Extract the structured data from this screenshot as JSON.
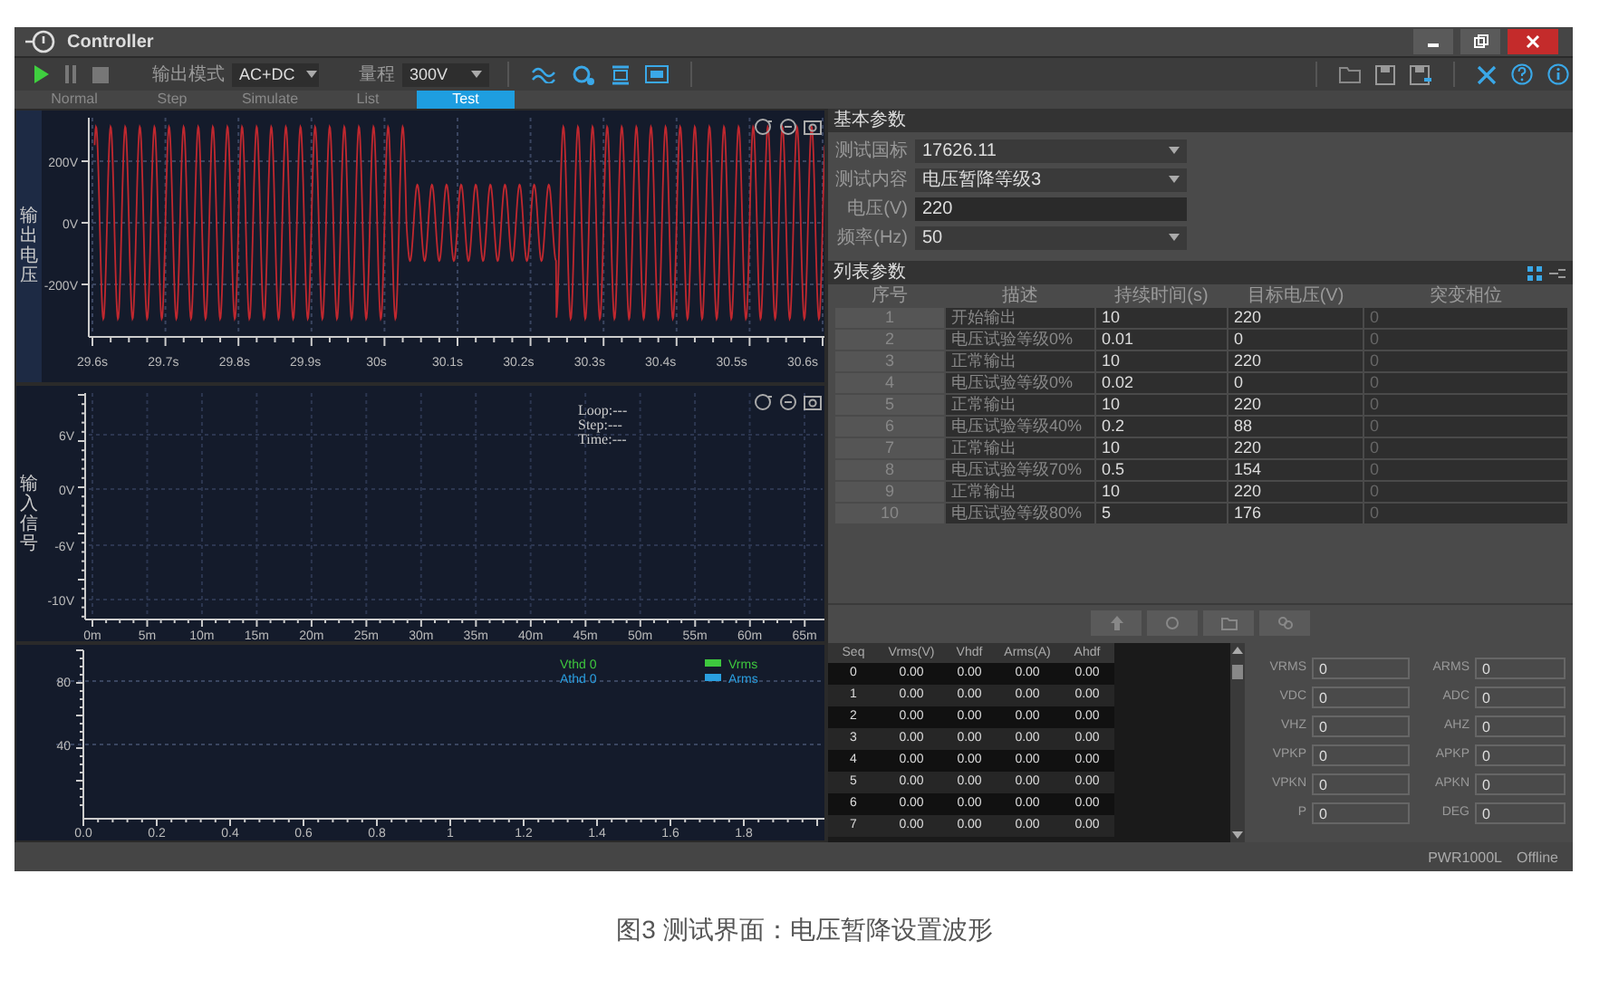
{
  "window": {
    "app_name": "Controller"
  },
  "toolbar": {
    "output_mode": {
      "label": "输出模式",
      "value": "AC+DC"
    },
    "range": {
      "label": "量程",
      "value": "300V"
    }
  },
  "tabs": [
    {
      "label": "Normal",
      "selected": false
    },
    {
      "label": "Step",
      "selected": false
    },
    {
      "label": "Simulate",
      "selected": false
    },
    {
      "label": "List",
      "selected": false
    },
    {
      "label": "Test",
      "selected": true
    }
  ],
  "waveform_chart": {
    "y_axis_title": "输出电压",
    "y_ticks": [
      "200V",
      "0V",
      "-200V"
    ],
    "x_ticks": [
      "29.6s",
      "29.7s",
      "29.8s",
      "29.9s",
      "30s",
      "30.1s",
      "30.2s",
      "30.3s",
      "30.4s",
      "30.5s",
      "30.6s"
    ]
  },
  "input_chart": {
    "y_axis_title": "输入信号",
    "y_ticks": [
      "6V",
      "0V",
      "-6V",
      "-10V"
    ],
    "x_ticks": [
      "0m",
      "5m",
      "10m",
      "15m",
      "20m",
      "25m",
      "30m",
      "35m",
      "40m",
      "45m",
      "50m",
      "55m",
      "60m",
      "65m"
    ],
    "overlay": [
      "Loop:---",
      "Step:---",
      "Time:---"
    ]
  },
  "harmonic_chart": {
    "y_ticks": [
      "80",
      "40"
    ],
    "x_ticks": [
      "0.0",
      "0.2",
      "0.4",
      "0.6",
      "0.8",
      "1",
      "1.2",
      "1.4",
      "1.6",
      "1.8"
    ],
    "thd": [
      {
        "text": "Vthd 0",
        "color": "#3ec83e"
      },
      {
        "text": "Athd 0",
        "color": "#2a9fe0"
      }
    ],
    "legend": [
      {
        "label": "Vrms",
        "color": "#3ec83e"
      },
      {
        "label": "Arms",
        "color": "#2a9fe0"
      }
    ]
  },
  "basic_params": {
    "title": "基本参数",
    "fields": [
      {
        "label": "测试国标",
        "value": "17626.11",
        "kind": "dropdown"
      },
      {
        "label": "测试内容",
        "value": "电压暂降等级3",
        "kind": "dropdown"
      },
      {
        "label": "电压(V)",
        "value": "220",
        "kind": "input"
      },
      {
        "label": "频率(Hz)",
        "value": "50",
        "kind": "dropdown"
      }
    ]
  },
  "list_params": {
    "title": "列表参数",
    "columns": [
      "序号",
      "描述",
      "持续时间(s)",
      "目标电压(V)",
      "突变相位"
    ],
    "rows": [
      {
        "index": "1",
        "description": "开始输出",
        "duration": "10",
        "voltage": "220",
        "phase": "0",
        "phase_disabled": true
      },
      {
        "index": "2",
        "description": "电压试验等级0%",
        "duration": "0.01",
        "voltage": "0",
        "phase": "0",
        "phase_disabled": true
      },
      {
        "index": "3",
        "description": "正常输出",
        "duration": "10",
        "voltage": "220",
        "phase": "0",
        "phase_disabled": true
      },
      {
        "index": "4",
        "description": "电压试验等级0%",
        "duration": "0.02",
        "voltage": "0",
        "phase": "0",
        "phase_disabled": true
      },
      {
        "index": "5",
        "description": "正常输出",
        "duration": "10",
        "voltage": "220",
        "phase": "0",
        "phase_disabled": true
      },
      {
        "index": "6",
        "description": "电压试验等级40%",
        "duration": "0.2",
        "voltage": "88",
        "phase": "0",
        "phase_disabled": true
      },
      {
        "index": "7",
        "description": "正常输出",
        "duration": "10",
        "voltage": "220",
        "phase": "0",
        "phase_disabled": true
      },
      {
        "index": "8",
        "description": "电压试验等级70%",
        "duration": "0.5",
        "voltage": "154",
        "phase": "0",
        "phase_disabled": true
      },
      {
        "index": "9",
        "description": "正常输出",
        "duration": "10",
        "voltage": "220",
        "phase": "0",
        "phase_disabled": true
      },
      {
        "index": "10",
        "description": "电压试验等级80%",
        "duration": "5",
        "voltage": "176",
        "phase": "0",
        "phase_disabled": true
      }
    ]
  },
  "seq_table": {
    "columns": [
      "Seq",
      "Vrms(V)",
      "Vhdf",
      "Arms(A)",
      "Ahdf"
    ],
    "rows": [
      [
        "0",
        "0.00",
        "0.00",
        "0.00",
        "0.00"
      ],
      [
        "1",
        "0.00",
        "0.00",
        "0.00",
        "0.00"
      ],
      [
        "2",
        "0.00",
        "0.00",
        "0.00",
        "0.00"
      ],
      [
        "3",
        "0.00",
        "0.00",
        "0.00",
        "0.00"
      ],
      [
        "4",
        "0.00",
        "0.00",
        "0.00",
        "0.00"
      ],
      [
        "5",
        "0.00",
        "0.00",
        "0.00",
        "0.00"
      ],
      [
        "6",
        "0.00",
        "0.00",
        "0.00",
        "0.00"
      ],
      [
        "7",
        "0.00",
        "0.00",
        "0.00",
        "0.00"
      ]
    ]
  },
  "measurements": [
    {
      "label": "VRMS",
      "value": "0"
    },
    {
      "label": "ARMS",
      "value": "0"
    },
    {
      "label": "VDC",
      "value": "0"
    },
    {
      "label": "ADC",
      "value": "0"
    },
    {
      "label": "VHZ",
      "value": "0"
    },
    {
      "label": "AHZ",
      "value": "0"
    },
    {
      "label": "VPKP",
      "value": "0"
    },
    {
      "label": "APKP",
      "value": "0"
    },
    {
      "label": "VPKN",
      "value": "0"
    },
    {
      "label": "APKN",
      "value": "0"
    },
    {
      "label": "P",
      "value": "0"
    },
    {
      "label": "DEG",
      "value": "0"
    }
  ],
  "status_bar": {
    "model": "PWR1000L",
    "state": "Offline"
  },
  "caption": "图3 测试界面：电压暂降设置波形"
}
